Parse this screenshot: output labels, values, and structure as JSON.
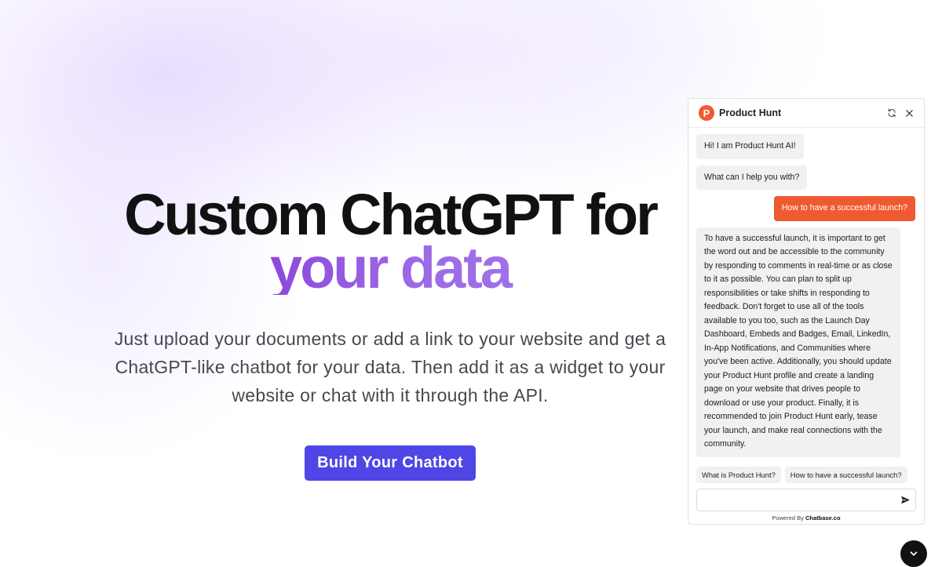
{
  "hero": {
    "title_line1": "Custom ChatGPT for",
    "title_line2": "your data",
    "subtitle": "Just upload your documents or add a link to your website and get a ChatGPT-like chatbot for your data. Then add it as a widget to your website or chat with it through the API.",
    "cta_label": "Build Your Chatbot"
  },
  "chat_widget": {
    "title": "Product Hunt",
    "logo_letter": "P",
    "icons": {
      "logo": "product-hunt-logo-icon",
      "refresh": "refresh-icon",
      "close": "close-icon",
      "send": "send-icon",
      "launcher": "chevron-down-icon"
    },
    "messages": [
      {
        "role": "bot",
        "text": "Hi! I am Product Hunt AI!"
      },
      {
        "role": "bot",
        "text": "What can I help you with?"
      },
      {
        "role": "user",
        "text": "How to have a successful launch?"
      },
      {
        "role": "bot",
        "text": "To have a successful launch, it is important to get the word out and be accessible to the community by responding to comments in real-time or as close to it as possible. You can plan to split up responsibilities or take shifts in responding to feedback. Don't forget to use all of the tools available to you too, such as the Launch Day Dashboard, Embeds and Badges, Email, LinkedIn, In-App Notifications, and Communities where you've been active. Additionally, you should update your Product Hunt profile and create a landing page on your website that drives people to download or use your product. Finally, it is recommended to join Product Hunt early, tease your launch, and make real connections with the community."
      }
    ],
    "suggestions": [
      "What is Product Hunt?",
      "How to have a successful launch?"
    ],
    "input_value": "",
    "powered_by_prefix": "Powered By",
    "powered_by_brand": "Chatbase.co"
  },
  "colors": {
    "accent_purple": "#7e22ce",
    "cta_indigo": "#4f46e5",
    "product_hunt_orange": "#f05a30"
  }
}
